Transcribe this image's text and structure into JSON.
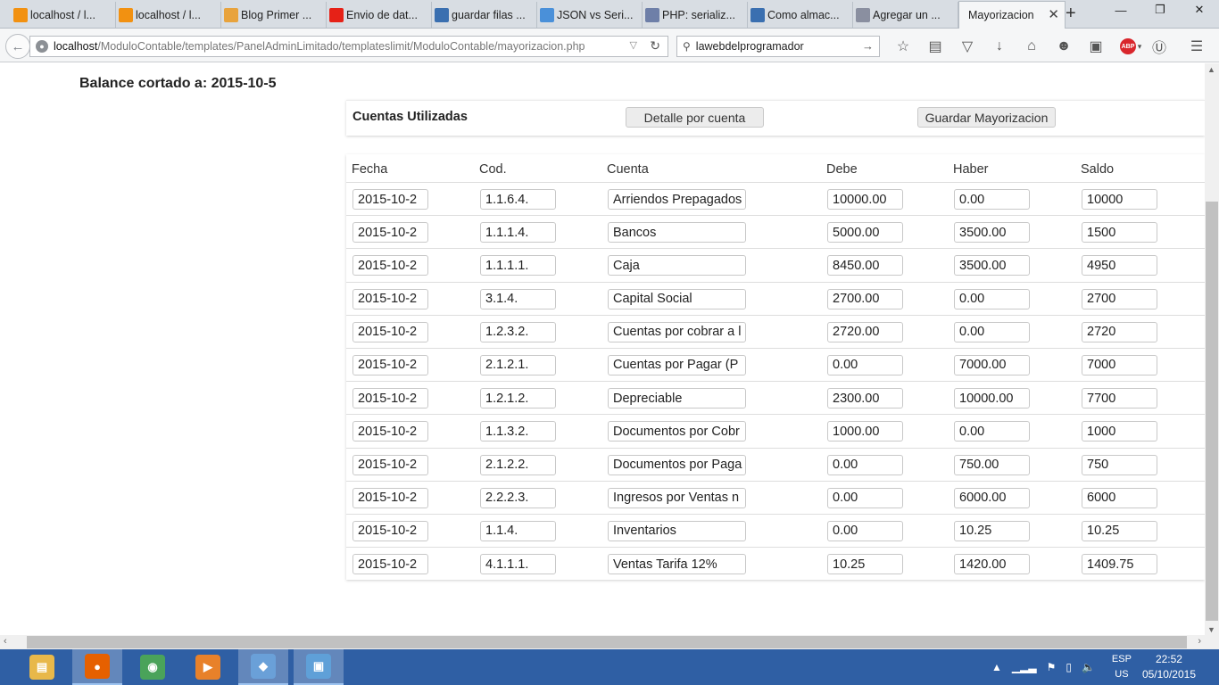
{
  "browser": {
    "tabs": [
      {
        "label": "localhost / l...",
        "icon": "phpmyadmin-icon",
        "color": "#f29111"
      },
      {
        "label": "localhost / l...",
        "icon": "phpmyadmin-icon",
        "color": "#f29111"
      },
      {
        "label": "Blog Primer ...",
        "icon": "blog-icon",
        "color": "#e8a33d"
      },
      {
        "label": "Envio de dat...",
        "icon": "youtube-icon",
        "color": "#e62117"
      },
      {
        "label": "guardar filas ...",
        "icon": "stackoverflow-icon",
        "color": "#3a6fb0"
      },
      {
        "label": "JSON vs Seri...",
        "icon": "code-icon",
        "color": "#4a90d9"
      },
      {
        "label": "PHP: serializ...",
        "icon": "php-icon",
        "color": "#6e7fa8"
      },
      {
        "label": "Como almac...",
        "icon": "stackoverflow-icon",
        "color": "#3a6fb0"
      },
      {
        "label": "Agregar un ...",
        "icon": "braces-icon",
        "color": "#8a8fa0"
      },
      {
        "label": "Mayorizacion",
        "icon": "",
        "color": "",
        "active": true
      }
    ],
    "url_host": "localhost",
    "url_path": "/ModuloContable/templates/PanelAdminLimitado/templateslimit/ModuloContable/mayorizacion.php",
    "search_value": "lawebdelprogramador"
  },
  "page": {
    "balance_label": "Balance cortado a: 2015-10-5",
    "panel_title": "Cuentas Utilizadas",
    "detalle_button": "Detalle por cuenta",
    "guardar_button": "Guardar Mayorizacion",
    "columns": [
      "Fecha",
      "Cod.",
      "Cuenta",
      "Debe",
      "Haber",
      "Saldo"
    ],
    "rows": [
      [
        "2015-10-2",
        "1.1.6.4.",
        "Arriendos Prepagados",
        "10000.00",
        "0.00",
        "10000"
      ],
      [
        "2015-10-2",
        "1.1.1.4.",
        "Bancos",
        "5000.00",
        "3500.00",
        "1500"
      ],
      [
        "2015-10-2",
        "1.1.1.1.",
        "Caja",
        "8450.00",
        "3500.00",
        "4950"
      ],
      [
        "2015-10-2",
        "3.1.4.",
        "Capital Social",
        "2700.00",
        "0.00",
        "2700"
      ],
      [
        "2015-10-2",
        "1.2.3.2.",
        "Cuentas por cobrar a l",
        "2720.00",
        "0.00",
        "2720"
      ],
      [
        "2015-10-2",
        "2.1.2.1.",
        "Cuentas por Pagar (P",
        "0.00",
        "7000.00",
        "7000"
      ],
      [
        "2015-10-2",
        "1.2.1.2.",
        "Depreciable",
        "2300.00",
        "10000.00",
        "7700"
      ],
      [
        "2015-10-2",
        "1.1.3.2.",
        "Documentos por Cobr",
        "1000.00",
        "0.00",
        "1000"
      ],
      [
        "2015-10-2",
        "2.1.2.2.",
        "Documentos por Paga",
        "0.00",
        "750.00",
        "750"
      ],
      [
        "2015-10-2",
        "2.2.2.3.",
        "Ingresos por Ventas n",
        "0.00",
        "6000.00",
        "6000"
      ],
      [
        "2015-10-2",
        "1.1.4.",
        "Inventarios",
        "0.00",
        "10.25",
        "10.25"
      ],
      [
        "2015-10-2",
        "4.1.1.1.",
        "Ventas Tarifa 12%",
        "10.25",
        "1420.00",
        "1409.75"
      ]
    ]
  },
  "taskbar": {
    "apps": [
      {
        "name": "file-explorer-icon",
        "color": "#e8b84a"
      },
      {
        "name": "firefox-icon",
        "color": "#e66000",
        "active": true
      },
      {
        "name": "chrome-icon",
        "color": "#4aa35a"
      },
      {
        "name": "media-player-icon",
        "color": "#e8812a"
      },
      {
        "name": "virtualbox-icon",
        "color": "#6aa0d8",
        "active": true
      },
      {
        "name": "window-app-icon",
        "color": "#5fa0d8",
        "active": true
      }
    ],
    "lang_top": "ESP",
    "lang_bottom": "US",
    "time": "22:52",
    "date": "05/10/2015"
  }
}
